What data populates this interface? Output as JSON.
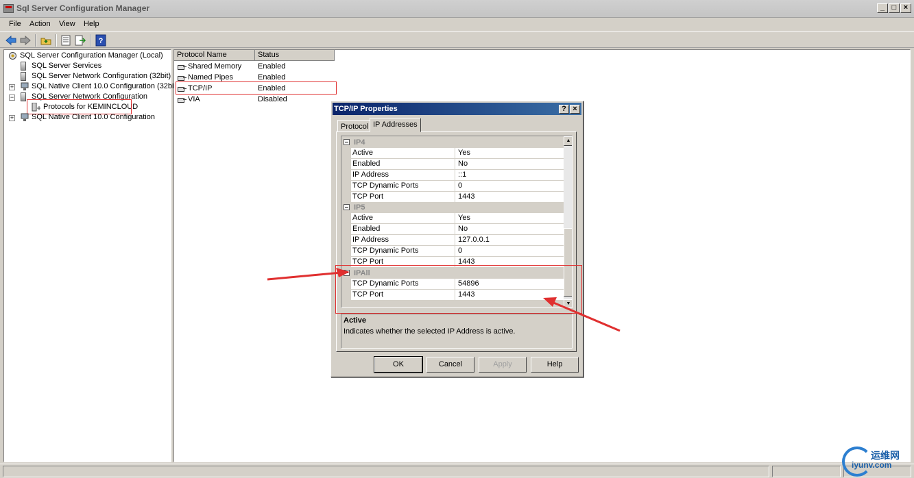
{
  "window": {
    "title": "Sql Server Configuration Manager"
  },
  "menu": [
    "File",
    "Action",
    "View",
    "Help"
  ],
  "tree": [
    {
      "label": "SQL Server Configuration Manager (Local)"
    },
    {
      "label": "SQL Server Services"
    },
    {
      "label": "SQL Server Network Configuration (32bit)"
    },
    {
      "label": "SQL Native Client 10.0 Configuration (32bit)"
    },
    {
      "label": "SQL Server Network Configuration"
    },
    {
      "label": "Protocols for KEMINCLOUD"
    },
    {
      "label": "SQL Native Client 10.0 Configuration"
    }
  ],
  "list": {
    "columns": [
      "Protocol Name",
      "Status"
    ],
    "rows": [
      {
        "name": "Shared Memory",
        "status": "Enabled"
      },
      {
        "name": "Named Pipes",
        "status": "Enabled"
      },
      {
        "name": "TCP/IP",
        "status": "Enabled"
      },
      {
        "name": "VIA",
        "status": "Disabled"
      }
    ]
  },
  "dialog": {
    "title": "TCP/IP Properties",
    "help_btn": "?",
    "close_btn": "×",
    "tabs": [
      "Protocol",
      "IP Addresses"
    ],
    "sections": [
      {
        "name": "IP4",
        "rows": [
          {
            "k": "Active",
            "v": "Yes"
          },
          {
            "k": "Enabled",
            "v": "No"
          },
          {
            "k": "IP Address",
            "v": "::1"
          },
          {
            "k": "TCP Dynamic Ports",
            "v": "0"
          },
          {
            "k": "TCP Port",
            "v": "1443"
          }
        ]
      },
      {
        "name": "IP5",
        "rows": [
          {
            "k": "Active",
            "v": "Yes"
          },
          {
            "k": "Enabled",
            "v": "No"
          },
          {
            "k": "IP Address",
            "v": "127.0.0.1"
          },
          {
            "k": "TCP Dynamic Ports",
            "v": "0"
          },
          {
            "k": "TCP Port",
            "v": "1443"
          }
        ]
      },
      {
        "name": "IPAll",
        "rows": [
          {
            "k": "TCP Dynamic Ports",
            "v": "54896"
          },
          {
            "k": "TCP Port",
            "v": "1443"
          }
        ]
      }
    ],
    "description": {
      "heading": "Active",
      "body": "Indicates whether the selected IP Address is active."
    },
    "buttons": {
      "ok": "OK",
      "cancel": "Cancel",
      "apply": "Apply",
      "help": "Help"
    }
  },
  "watermark": {
    "cn": "运维网",
    "en": "iyunv.com"
  },
  "annotation_color": "#e03030"
}
